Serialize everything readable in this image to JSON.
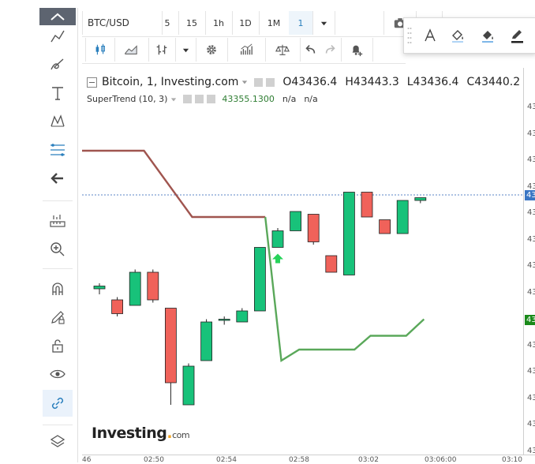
{
  "toolbar": {
    "symbol": "BTC/USD",
    "intervals": [
      "5",
      "15",
      "1h",
      "1D",
      "1M",
      "1"
    ],
    "active_interval_index": 5,
    "dropdown_icon": "caret-down-icon"
  },
  "legend": {
    "title": "Bitcoin, 1, Investing.com",
    "open": "O43436.4",
    "high": "H43443.3",
    "low": "L43436.4",
    "close": "C43440.2",
    "indicator": "SuperTrend (10, 3)",
    "indicator_value": "43355.1300",
    "na1": "n/a",
    "na2": "n/a"
  },
  "price_axis": {
    "labels": [
      "43",
      "43",
      "43",
      "43",
      "43",
      "43",
      "43",
      "43",
      "43",
      "43",
      "43",
      "43",
      "43",
      "43"
    ],
    "current_price_tag": "43",
    "supertrend_tag": "43",
    "current_price_color": "#3a76c4",
    "supertrend_tag_color": "#1a8a1a"
  },
  "time_axis": {
    "labels": [
      "46",
      "02:50",
      "02:54",
      "02:58",
      "03:02",
      "03:06:00",
      "03:10"
    ]
  },
  "watermark": {
    "brand": "Investing",
    "suffix": "com"
  },
  "colors": {
    "up": "#18c27a",
    "down": "#f0625a",
    "supertrend_down": "#a0554f",
    "supertrend_up": "#5aa85a",
    "accent": "#2a7fbd"
  },
  "chart_data": {
    "type": "candlestick",
    "candles": [
      {
        "t": 0,
        "o": 43360,
        "h": 43362,
        "l": 43358,
        "c": 43361
      },
      {
        "t": 1,
        "o": 43356,
        "h": 43357,
        "l": 43350,
        "c": 43351
      },
      {
        "t": 2,
        "o": 43354,
        "h": 43367,
        "l": 43354,
        "c": 43366
      },
      {
        "t": 3,
        "o": 43366,
        "h": 43367,
        "l": 43355,
        "c": 43356
      },
      {
        "t": 4,
        "o": 43353,
        "h": 43353,
        "l": 43318,
        "c": 43326
      },
      {
        "t": 5,
        "o": 43318,
        "h": 43333,
        "l": 43318,
        "c": 43332
      },
      {
        "t": 6,
        "o": 43334,
        "h": 43349,
        "l": 43334,
        "c": 43348
      },
      {
        "t": 7,
        "o": 43349,
        "h": 43350,
        "l": 43347,
        "c": 43349
      },
      {
        "t": 8,
        "o": 43348,
        "h": 43353,
        "l": 43348,
        "c": 43352
      },
      {
        "t": 9,
        "o": 43352,
        "h": 43375,
        "l": 43352,
        "c": 43375
      },
      {
        "t": 10,
        "o": 43375,
        "h": 43382,
        "l": 43375,
        "c": 43381
      },
      {
        "t": 11,
        "o": 43381,
        "h": 43388,
        "l": 43381,
        "c": 43388
      },
      {
        "t": 12,
        "o": 43387,
        "h": 43387,
        "l": 43376,
        "c": 43377
      },
      {
        "t": 13,
        "o": 43372,
        "h": 43372,
        "l": 43366,
        "c": 43366
      },
      {
        "t": 14,
        "o": 43365,
        "h": 43395,
        "l": 43365,
        "c": 43395
      },
      {
        "t": 15,
        "o": 43395,
        "h": 43395,
        "l": 43386,
        "c": 43386
      },
      {
        "t": 16,
        "o": 43385,
        "h": 43385,
        "l": 43380,
        "c": 43380
      },
      {
        "t": 17,
        "o": 43380,
        "h": 43392,
        "l": 43380,
        "c": 43392
      },
      {
        "t": 18,
        "o": 43392,
        "h": 43393,
        "l": 43391,
        "c": 43393
      }
    ],
    "supertrend_down": [
      [
        -1,
        43410
      ],
      [
        2.5,
        43410
      ],
      [
        5.2,
        43386
      ],
      [
        9.3,
        43386
      ]
    ],
    "supertrend_up": [
      [
        9.3,
        43386
      ],
      [
        10.2,
        43334
      ],
      [
        11.2,
        43338
      ],
      [
        14.3,
        43338
      ],
      [
        15.2,
        43343
      ],
      [
        17.2,
        43343
      ],
      [
        18.2,
        43349
      ]
    ],
    "current_price": 43394,
    "buy_signal_index": 10
  }
}
